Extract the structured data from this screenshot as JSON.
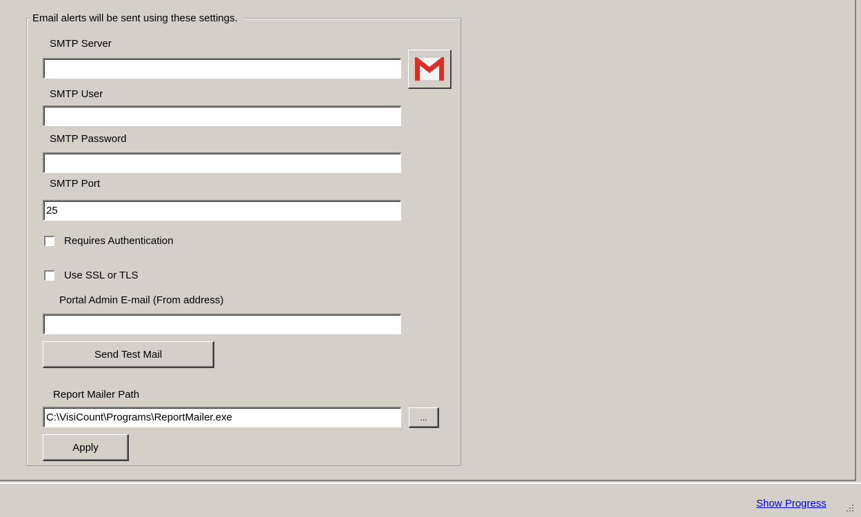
{
  "group": {
    "legend": "Email alerts will be sent using these settings."
  },
  "fields": {
    "smtp_server": {
      "label": "SMTP Server",
      "value": ""
    },
    "smtp_user": {
      "label": "SMTP User",
      "value": ""
    },
    "smtp_password": {
      "label": "SMTP Password",
      "value": ""
    },
    "smtp_port": {
      "label": "SMTP Port",
      "value": "25"
    },
    "admin_email": {
      "label": "Portal Admin E-mail (From address)",
      "value": ""
    },
    "report_mailer_path": {
      "label": "Report Mailer Path",
      "value": "C:\\VisiCount\\Programs\\ReportMailer.exe"
    }
  },
  "checkboxes": {
    "requires_auth": {
      "label": "Requires Authentication",
      "checked": false
    },
    "use_ssl": {
      "label": "Use SSL or TLS",
      "checked": false
    }
  },
  "buttons": {
    "send_test_mail": "Send Test Mail",
    "browse": "...",
    "apply": "Apply",
    "gmail_icon": "gmail-icon"
  },
  "status": {
    "show_progress": "Show Progress"
  },
  "colors": {
    "background": "#d4d0c8",
    "gmail_red": "#d93025",
    "link": "#0000ee"
  }
}
